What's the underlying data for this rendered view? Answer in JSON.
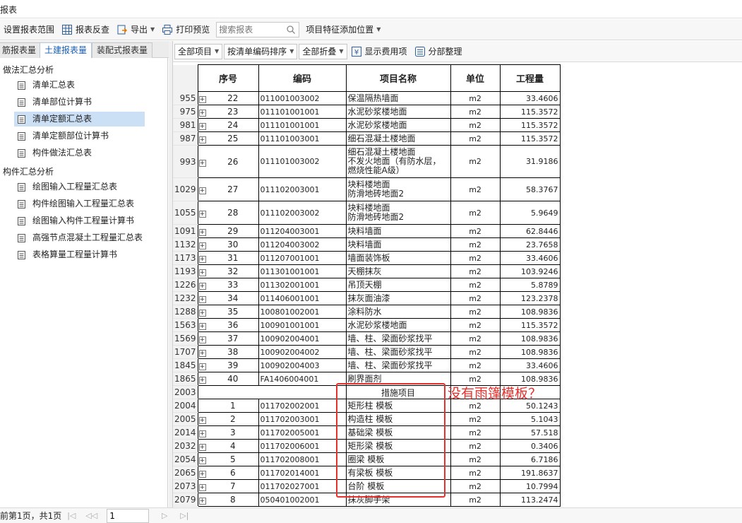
{
  "window": {
    "title": "报表"
  },
  "toolbar": {
    "settings_label": "设置报表范围",
    "review_label": "报表反查",
    "export_label": "导出",
    "preview_label": "打印预览",
    "search_placeholder": "搜索报表",
    "feature_position_label": "项目特征添加位置"
  },
  "tabs": [
    {
      "label": "筋报表量"
    },
    {
      "label": "土建报表量"
    },
    {
      "label": "装配式报表量"
    }
  ],
  "tree": {
    "group1": "做法汇总分析",
    "group1_items": [
      "清单汇总表",
      "清单部位计算书",
      "清单定额汇总表",
      "清单定额部位计算书",
      "构件做法汇总表"
    ],
    "group2": "构件汇总分析",
    "group2_items": [
      "绘图输入工程量汇总表",
      "构件绘图输入工程量汇总表",
      "绘图输入构件工程量计算书",
      "高强节点混凝土工程量汇总表",
      "表格算量工程量计算书"
    ]
  },
  "toolbar2": {
    "all_items": "全部项目",
    "sort_label": "按清单编码排序",
    "fold_label": "全部折叠",
    "show_fee_label": "显示费用项",
    "subdivision_label": "分部整理"
  },
  "table": {
    "headers": {
      "seq": "序号",
      "code": "编码",
      "name": "项目名称",
      "unit": "单位",
      "qty": "工程量"
    },
    "rows": [
      {
        "rn": "955",
        "seq": "22",
        "code": "011001003002",
        "name": "保温隔热墙面",
        "unit": "m2",
        "qty": "33.4606"
      },
      {
        "rn": "975",
        "seq": "23",
        "code": "011101001001",
        "name": "水泥砂浆楼地面",
        "unit": "m2",
        "qty": "115.3572"
      },
      {
        "rn": "981",
        "seq": "24",
        "code": "011101001001",
        "name": "水泥砂浆楼地面",
        "unit": "m2",
        "qty": "115.3572"
      },
      {
        "rn": "987",
        "seq": "25",
        "code": "011101003001",
        "name": "细石混凝土楼地面",
        "unit": "m2",
        "qty": "115.3572"
      },
      {
        "rn": "993",
        "seq": "26",
        "code": "011101003002",
        "name": "细石混凝土楼地面\n不发火地面（有防水层，燃烧性能A级）",
        "unit": "m2",
        "qty": "31.9186"
      },
      {
        "rn": "1029",
        "seq": "27",
        "code": "011102003001",
        "name": "块料楼地面\n防滑地砖地面2",
        "unit": "m2",
        "qty": "58.3767"
      },
      {
        "rn": "1055",
        "seq": "28",
        "code": "011102003002",
        "name": "块料楼地面\n防滑地砖地面2",
        "unit": "m2",
        "qty": "5.9649"
      },
      {
        "rn": "1091",
        "seq": "29",
        "code": "011204003001",
        "name": "块料墙面",
        "unit": "m2",
        "qty": "62.8446"
      },
      {
        "rn": "1132",
        "seq": "30",
        "code": "011204003002",
        "name": "块料墙面",
        "unit": "m2",
        "qty": "23.7658"
      },
      {
        "rn": "1173",
        "seq": "31",
        "code": "011207001001",
        "name": "墙面装饰板",
        "unit": "m2",
        "qty": "33.4606"
      },
      {
        "rn": "1193",
        "seq": "32",
        "code": "011301001001",
        "name": "天棚抹灰",
        "unit": "m2",
        "qty": "103.9246"
      },
      {
        "rn": "1226",
        "seq": "33",
        "code": "011302001001",
        "name": "吊顶天棚",
        "unit": "m2",
        "qty": "5.8789"
      },
      {
        "rn": "1232",
        "seq": "34",
        "code": "011406001001",
        "name": "抹灰面油漆",
        "unit": "m2",
        "qty": "123.2378"
      },
      {
        "rn": "1288",
        "seq": "35",
        "code": "100801002001",
        "name": "涂料防水",
        "unit": "m2",
        "qty": "108.9836"
      },
      {
        "rn": "1563",
        "seq": "36",
        "code": "100901001001",
        "name": "水泥砂浆楼地面",
        "unit": "m2",
        "qty": "115.3572"
      },
      {
        "rn": "1569",
        "seq": "37",
        "code": "100902004001",
        "name": "墙、柱、梁面砂浆找平",
        "unit": "m2",
        "qty": "108.9836"
      },
      {
        "rn": "1707",
        "seq": "38",
        "code": "100902004002",
        "name": "墙、柱、梁面砂浆找平",
        "unit": "m2",
        "qty": "108.9836"
      },
      {
        "rn": "1845",
        "seq": "39",
        "code": "100902004003",
        "name": "墙、柱、梁面砂浆找平",
        "unit": "m2",
        "qty": "33.4606"
      },
      {
        "rn": "1865",
        "seq": "40",
        "code": "FA1406004001",
        "name": "刷界面剂",
        "unit": "m2",
        "qty": "108.9836"
      }
    ],
    "section_rn": "2003",
    "section_label": "措施项目",
    "measure_rows": [
      {
        "rn": "2004",
        "seq": "1",
        "code": "011702002001",
        "name": "矩形柱 模板",
        "unit": "m2",
        "qty": "50.1243",
        "expand": false
      },
      {
        "rn": "2005",
        "seq": "2",
        "code": "011702003001",
        "name": "构造柱 模板",
        "unit": "m2",
        "qty": "5.1043",
        "expand": true
      },
      {
        "rn": "2014",
        "seq": "3",
        "code": "011702005001",
        "name": "基础梁 模板",
        "unit": "m2",
        "qty": "57.518",
        "expand": true
      },
      {
        "rn": "2032",
        "seq": "4",
        "code": "011702006001",
        "name": "矩形梁 模板",
        "unit": "m2",
        "qty": "0.3406",
        "expand": true
      },
      {
        "rn": "2054",
        "seq": "5",
        "code": "011702008001",
        "name": "圈梁 模板",
        "unit": "m2",
        "qty": "6.7186",
        "expand": true
      },
      {
        "rn": "2065",
        "seq": "6",
        "code": "011702014001",
        "name": "有梁板 模板",
        "unit": "m2",
        "qty": "191.8637",
        "expand": true
      },
      {
        "rn": "2073",
        "seq": "7",
        "code": "011702027001",
        "name": "台阶 模板",
        "unit": "m2",
        "qty": "10.7994",
        "expand": true
      },
      {
        "rn": "2079",
        "seq": "8",
        "code": "050401002001",
        "name": "抹灰脚手架",
        "unit": "m2",
        "qty": "113.2474",
        "expand": true
      }
    ]
  },
  "annotation": {
    "text": "没有雨篷模板？",
    "color": "#e5302c"
  },
  "status": {
    "page_text": "前第1页，共1页",
    "page_value": "1"
  },
  "colors": {
    "selected_bg": "#cce0f5",
    "active_tab_text": "#1a5fb4"
  }
}
